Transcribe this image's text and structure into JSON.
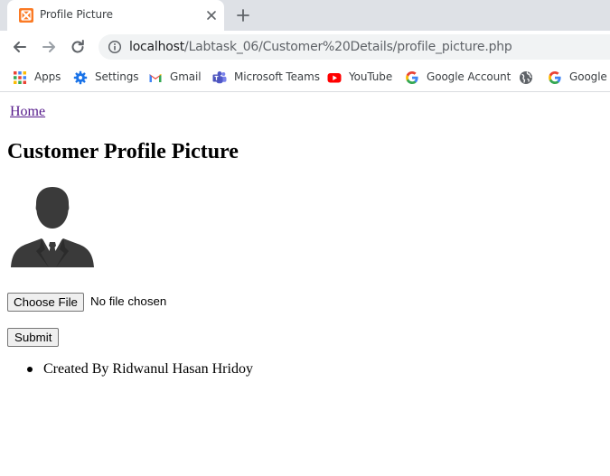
{
  "browser": {
    "tab": {
      "title": "Profile Picture",
      "favicon": "xampp-icon"
    },
    "address_bar": {
      "host": "localhost",
      "path": "/Labtask_06/Customer%20Details/profile_picture.php"
    },
    "bookmarks": [
      {
        "label": "Apps",
        "icon": "apps-grid-icon"
      },
      {
        "label": "Settings",
        "icon": "gear-icon"
      },
      {
        "label": "Gmail",
        "icon": "gmail-icon"
      },
      {
        "label": "Microsoft Teams",
        "icon": "teams-icon"
      },
      {
        "label": "YouTube",
        "icon": "youtube-icon"
      },
      {
        "label": "Google Account",
        "icon": "google-icon"
      },
      {
        "label": "",
        "icon": "globe-icon"
      },
      {
        "label": "Google",
        "icon": "google-icon"
      }
    ]
  },
  "page": {
    "home_link": "Home",
    "title": "Customer Profile Picture",
    "avatar_icon": "businessman-silhouette-icon",
    "file_input": {
      "button_label": "Choose File",
      "status": "No file chosen"
    },
    "submit_label": "Submit",
    "credits": [
      "Created By Ridwanul Hasan Hridoy"
    ]
  },
  "colors": {
    "tabstrip_bg": "#dee1e6",
    "omnibox_bg": "#f1f3f4",
    "visited_link": "#551a8b",
    "button_bg": "#efefef"
  }
}
